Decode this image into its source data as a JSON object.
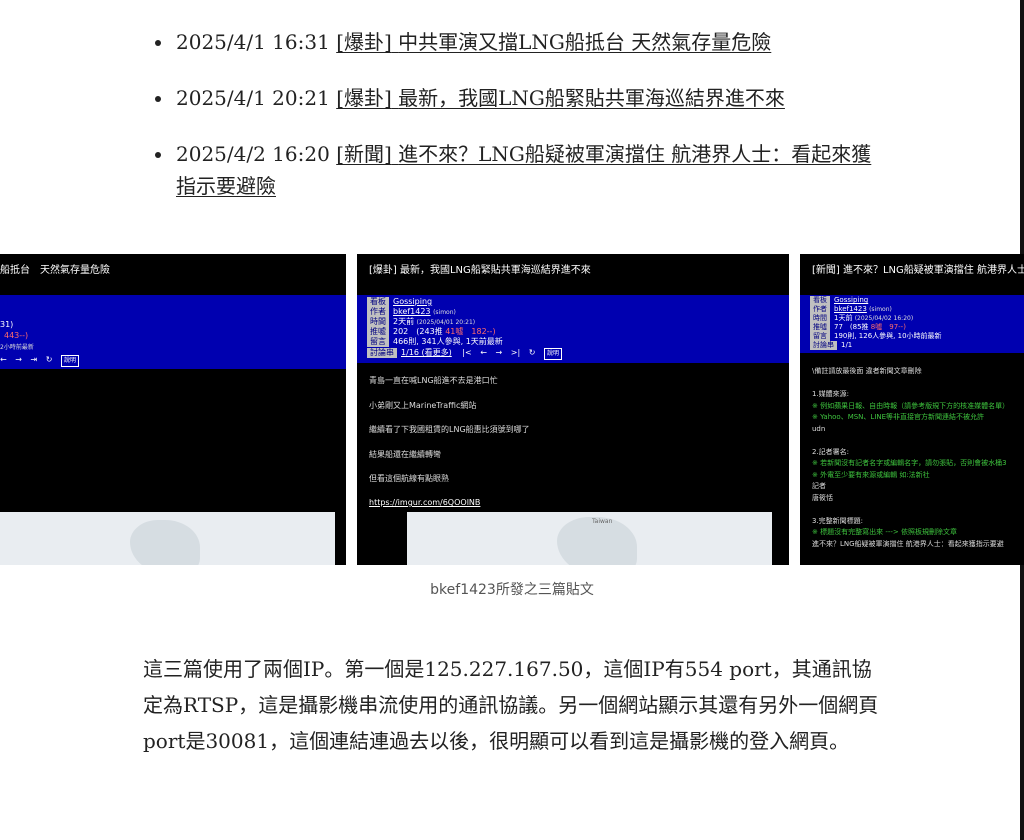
{
  "links": [
    {
      "date": "2025/4/1 16:31",
      "tag": "[爆卦]",
      "title": "中共軍演又擋LNG船抵台 天然氣存量危險"
    },
    {
      "date": "2025/4/1 20:21",
      "tag": "[爆卦]",
      "title": "最新，我國LNG船緊貼共軍海巡結界進不來"
    },
    {
      "date": "2025/4/2 16:20",
      "tag": "[新聞]",
      "title": "進不來？LNG船疑被軍演擋住 航港界人士：看起來獲指示要避險"
    }
  ],
  "shot1": {
    "title": "船抵台　天然氣存量危險",
    "lines": [
      "31)",
      "443--)",
      "2小時前最新"
    ]
  },
  "shot2": {
    "title": "[爆卦] 最新，我國LNG船緊貼共軍海巡結界進不來",
    "meta": [
      {
        "k": "看板",
        "v": "Gossiping"
      },
      {
        "k": "作者",
        "v": "bkef1423",
        "extra": "(simon)"
      },
      {
        "k": "時間",
        "v": "2天前",
        "extra": "(2025/04/01 20:21)"
      },
      {
        "k": "推噓",
        "v": "202　(243推",
        "red": "41噓　182--)"
      },
      {
        "k": "留言",
        "v": "466則, 341人參與, 1天前最新"
      },
      {
        "k": "討論串",
        "v": "1/16 (看更多)"
      }
    ],
    "body": [
      "青島一直在喊LNG船進不去是港口忙",
      "小弟剛又上MarineTraffic網站",
      "繼續看了下我國租賃的LNG船惠比須號到哪了",
      "結果船還在繼續轉彎",
      "但看這個航線有點眼熟",
      "https://imgur.com/6QOOlNB"
    ],
    "map_label": "Taiwan"
  },
  "shot3": {
    "title": "[新聞] 進不來？LNG船疑被軍演擋住 航港界人士：看起",
    "meta": [
      {
        "k": "看板",
        "v": "Gossiping"
      },
      {
        "k": "作者",
        "v": "bkef1423",
        "extra": "(simon)"
      },
      {
        "k": "時間",
        "v": "1天前",
        "extra": "(2025/04/02 16:20)"
      },
      {
        "k": "推噓",
        "v": "77　(85推",
        "red": "8噓　97--)"
      },
      {
        "k": "留言",
        "v": "190則, 126人參與, 10小時前最新"
      },
      {
        "k": "討論串",
        "v": "1/1"
      }
    ],
    "body": [
      {
        "t": "\\備註請放最後面 違者新聞文章刪除",
        "c": "w"
      },
      {
        "t": "",
        "c": "w"
      },
      {
        "t": "1.媒體來源:",
        "c": "w"
      },
      {
        "t": "※ 例如蘋果日報、自由時報（請參考版規下方的核准媒體名單）",
        "c": "g"
      },
      {
        "t": "※ Yahoo、MSN、LINE等非直接官方新聞連結不被允許",
        "c": "g"
      },
      {
        "t": "udn",
        "c": "w"
      },
      {
        "t": "",
        "c": "w"
      },
      {
        "t": "2.記者署名:",
        "c": "w"
      },
      {
        "t": "※ 若新聞沒有記者名字或編輯名字，請勿張貼，否則會被水桶3",
        "c": "g"
      },
      {
        "t": "※ 外電至少要有來源或編輯 如:法新社",
        "c": "g"
      },
      {
        "t": "記者",
        "c": "w"
      },
      {
        "t": "唐筱恬",
        "c": "w"
      },
      {
        "t": "",
        "c": "w"
      },
      {
        "t": "3.完整新聞標題:",
        "c": "w"
      },
      {
        "t": "※ 標題沒有完整寫出來 ---> 依照板規刪除文章",
        "c": "g"
      },
      {
        "t": "進不來？LNG船疑被軍演擋住 航港界人士：看起來獲指示要避",
        "c": "w"
      }
    ]
  },
  "caption": "bkef1423所發之三篇貼文",
  "paragraph": "這三篇使用了兩個IP。第一個是125.227.167.50，這個IP有554 port，其通訊協定為RTSP，這是攝影機串流使用的通訊協議。另一個網站顯示其還有另外一個網頁port是30081，這個連結連過去以後，很明顯可以看到這是攝影機的登入網頁。",
  "colors": {
    "banner": "#0000b0",
    "push_red": "#ff6b6b",
    "note_green": "#3ec43e"
  }
}
